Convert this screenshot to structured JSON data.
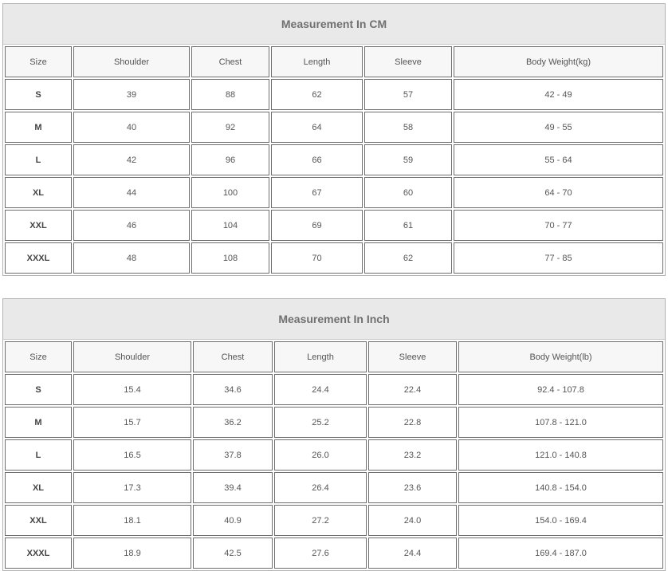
{
  "tables": [
    {
      "title": "Measurement In CM",
      "headers": [
        "Size",
        "Shoulder",
        "Chest",
        "Length",
        "Sleeve",
        "Body Weight(kg)"
      ],
      "rows": [
        [
          "S",
          "39",
          "88",
          "62",
          "57",
          "42 - 49"
        ],
        [
          "M",
          "40",
          "92",
          "64",
          "58",
          "49 - 55"
        ],
        [
          "L",
          "42",
          "96",
          "66",
          "59",
          "55 - 64"
        ],
        [
          "XL",
          "44",
          "100",
          "67",
          "60",
          "64 - 70"
        ],
        [
          "XXL",
          "46",
          "104",
          "69",
          "61",
          "70 - 77"
        ],
        [
          "XXXL",
          "48",
          "108",
          "70",
          "62",
          "77 - 85"
        ]
      ]
    },
    {
      "title": "Measurement In Inch",
      "headers": [
        "Size",
        "Shoulder",
        "Chest",
        "Length",
        "Sleeve",
        "Body Weight(lb)"
      ],
      "rows": [
        [
          "S",
          "15.4",
          "34.6",
          "24.4",
          "22.4",
          "92.4 - 107.8"
        ],
        [
          "M",
          "15.7",
          "36.2",
          "25.2",
          "22.8",
          "107.8 - 121.0"
        ],
        [
          "L",
          "16.5",
          "37.8",
          "26.0",
          "23.2",
          "121.0 - 140.8"
        ],
        [
          "XL",
          "17.3",
          "39.4",
          "26.4",
          "23.6",
          "140.8 - 154.0"
        ],
        [
          "XXL",
          "18.1",
          "40.9",
          "27.2",
          "24.0",
          "154.0 - 169.4"
        ],
        [
          "XXXL",
          "18.9",
          "42.5",
          "27.6",
          "24.4",
          "169.4 - 187.0"
        ]
      ]
    }
  ]
}
